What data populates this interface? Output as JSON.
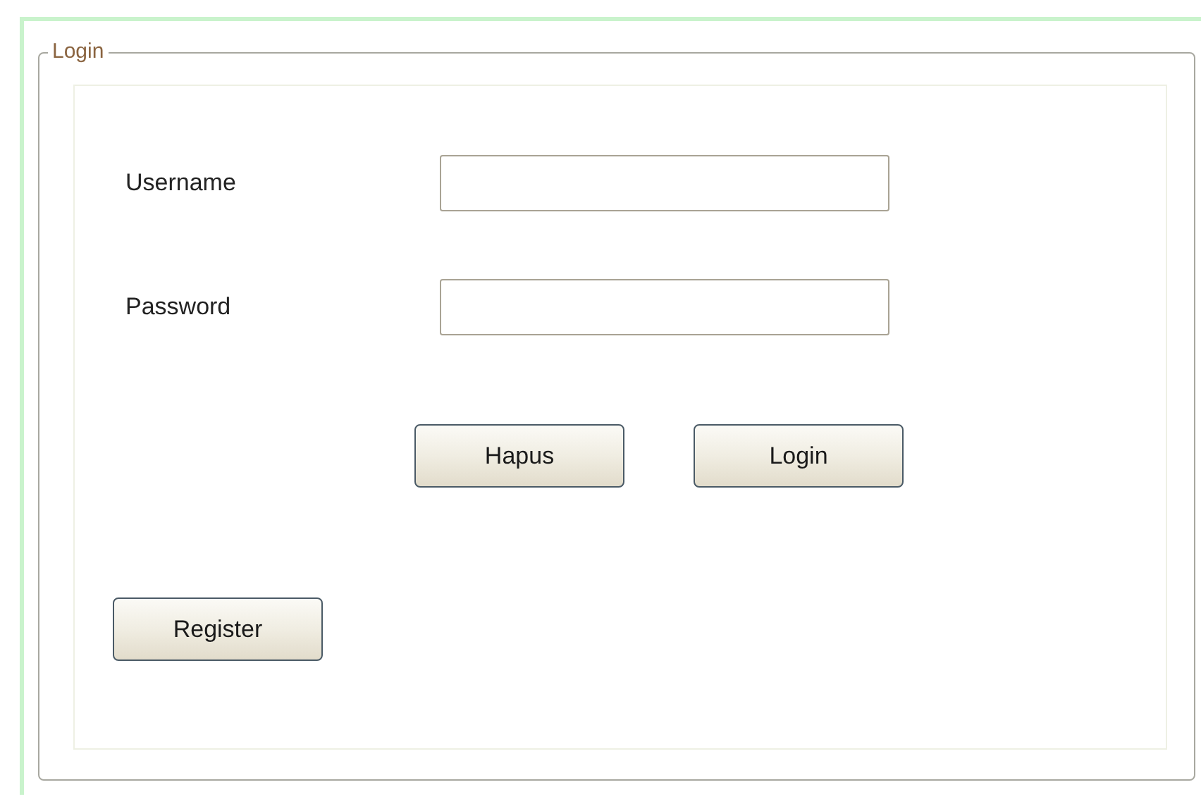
{
  "group": {
    "title": "Login"
  },
  "fields": [
    {
      "label": "Username"
    },
    {
      "label": "Password"
    }
  ],
  "buttons": [
    "Hapus",
    "Login"
  ],
  "register_button": "Register"
}
